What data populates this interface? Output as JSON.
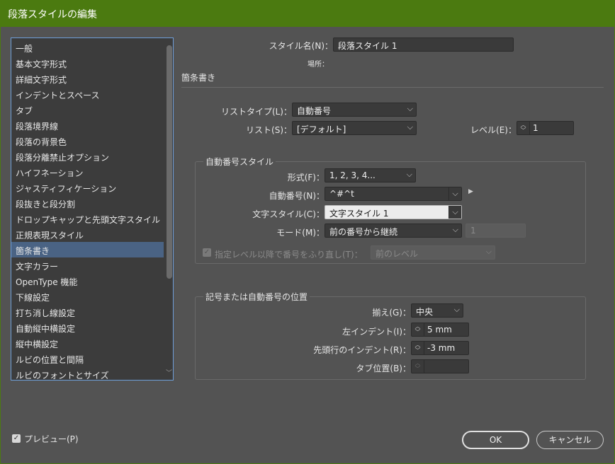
{
  "window": {
    "title": "段落スタイルの編集"
  },
  "categories": [
    "一般",
    "基本文字形式",
    "詳細文字形式",
    "インデントとスペース",
    "タブ",
    "段落境界線",
    "段落の背景色",
    "段落分離禁止オプション",
    "ハイフネーション",
    "ジャスティフィケーション",
    "段抜きと段分割",
    "ドロップキャップと先頭文字スタイル",
    "正規表現スタイル",
    "箇条書き",
    "文字カラー",
    "OpenType 機能",
    "下線設定",
    "打ち消し線設定",
    "自動縦中横設定",
    "縦中横設定",
    "ルビの位置と間隔",
    "ルビのフォントとサイズ"
  ],
  "selected_category": "箇条書き",
  "header": {
    "style_name_label": "スタイル名(N)：",
    "style_name_value": "段落スタイル 1",
    "location_label": "場所："
  },
  "section": {
    "title": "箇条書き"
  },
  "list_type": {
    "label": "リストタイプ(L)：",
    "value": "自動番号"
  },
  "list": {
    "label": "リスト(S)：",
    "value": "[デフォルト]"
  },
  "level": {
    "label": "レベル(E)：",
    "value": "1"
  },
  "numbering_style": {
    "title": "自動番号スタイル",
    "format_label": "形式(F)：",
    "format_value": "1, 2, 3, 4...",
    "number_label": "自動番号(N)：",
    "number_value": "^#^t",
    "char_style_label": "文字スタイル(C)：",
    "char_style_value": "文字スタイル 1",
    "mode_label": "モード(M)：",
    "mode_value": "前の番号から継続",
    "mode_start": "1",
    "restart_label": "指定レベル以降で番号をふり直し(T)：",
    "restart_value": "前のレベル",
    "restart_checked": true
  },
  "position": {
    "title": "記号または自動番号の位置",
    "align_label": "揃え(G)：",
    "align_value": "中央",
    "left_indent_label": "左インデント(I)：",
    "left_indent_value": "5 mm",
    "first_line_label": "先頭行のインデント(R)：",
    "first_line_value": "-3 mm",
    "tab_label": "タブ位置(B)：",
    "tab_value": ""
  },
  "footer": {
    "preview_label": "プレビュー(P)",
    "preview_checked": true,
    "ok_label": "OK",
    "cancel_label": "キャンセル"
  },
  "colors": {
    "titlebar": "#4b7a10",
    "selection": "#4a6384",
    "background": "#535353"
  }
}
